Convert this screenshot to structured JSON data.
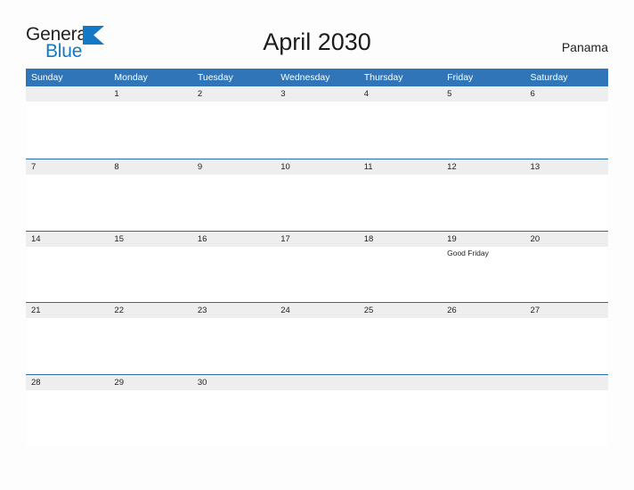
{
  "brand": {
    "name_part1": "General",
    "name_part2": "Blue",
    "flag_icon": "triangle-flag-icon",
    "accent_color": "#1379c4"
  },
  "header": {
    "title": "April 2030",
    "country": "Panama"
  },
  "theme": {
    "header_blue": "#3075b8",
    "rule_blue": "#2a6ba8",
    "date_strip_gray": "#eeeeee",
    "page_background": "#fdfdfd",
    "text_dark": "#1f1f1f"
  },
  "calendar": {
    "month": "April",
    "year": "2030",
    "day_headers": [
      "Sunday",
      "Monday",
      "Tuesday",
      "Wednesday",
      "Thursday",
      "Friday",
      "Saturday"
    ],
    "weeks": [
      {
        "days": [
          {
            "date": "",
            "events": []
          },
          {
            "date": "1",
            "events": []
          },
          {
            "date": "2",
            "events": []
          },
          {
            "date": "3",
            "events": []
          },
          {
            "date": "4",
            "events": []
          },
          {
            "date": "5",
            "events": []
          },
          {
            "date": "6",
            "events": []
          }
        ]
      },
      {
        "days": [
          {
            "date": "7",
            "events": []
          },
          {
            "date": "8",
            "events": []
          },
          {
            "date": "9",
            "events": []
          },
          {
            "date": "10",
            "events": []
          },
          {
            "date": "11",
            "events": []
          },
          {
            "date": "12",
            "events": []
          },
          {
            "date": "13",
            "events": []
          }
        ]
      },
      {
        "days": [
          {
            "date": "14",
            "events": []
          },
          {
            "date": "15",
            "events": []
          },
          {
            "date": "16",
            "events": []
          },
          {
            "date": "17",
            "events": []
          },
          {
            "date": "18",
            "events": []
          },
          {
            "date": "19",
            "events": [
              "Good Friday"
            ]
          },
          {
            "date": "20",
            "events": []
          }
        ]
      },
      {
        "days": [
          {
            "date": "21",
            "events": []
          },
          {
            "date": "22",
            "events": []
          },
          {
            "date": "23",
            "events": []
          },
          {
            "date": "24",
            "events": []
          },
          {
            "date": "25",
            "events": []
          },
          {
            "date": "26",
            "events": []
          },
          {
            "date": "27",
            "events": []
          }
        ]
      },
      {
        "days": [
          {
            "date": "28",
            "events": []
          },
          {
            "date": "29",
            "events": []
          },
          {
            "date": "30",
            "events": []
          },
          {
            "date": "",
            "events": []
          },
          {
            "date": "",
            "events": []
          },
          {
            "date": "",
            "events": []
          },
          {
            "date": "",
            "events": []
          }
        ]
      }
    ]
  }
}
